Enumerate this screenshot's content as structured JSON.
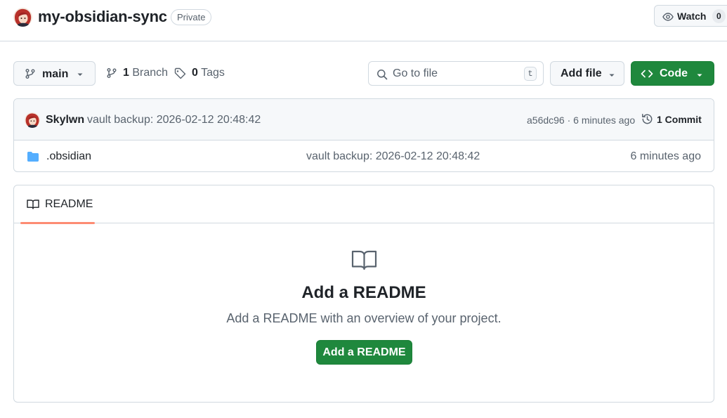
{
  "repo": {
    "name": "my-obsidian-sync",
    "visibility": "Private"
  },
  "watch": {
    "label": "Watch",
    "count": "0"
  },
  "toolbar": {
    "branch_current": "main",
    "branches_count": "1",
    "branches_label": "Branch",
    "tags_count": "0",
    "tags_label": "Tags",
    "search_placeholder": "Go to file",
    "search_shortcut": "t",
    "add_file_label": "Add file",
    "code_label": "Code"
  },
  "latest_commit": {
    "author": "Skylwn",
    "message": "vault backup: 2026-02-12 20:48:42",
    "sha_and_time": "a56dc96 · 6 minutes ago",
    "commit_count_label": "1 Commit"
  },
  "files": [
    {
      "name": ".obsidian",
      "type": "folder",
      "message": "vault backup: 2026-02-12 20:48:42",
      "age": "6 minutes ago"
    }
  ],
  "readme": {
    "tab_label": "README",
    "empty_title": "Add a README",
    "empty_description": "Add a README with an overview of your project.",
    "button_label": "Add a README"
  },
  "colors": {
    "primary_green": "#1f883d",
    "border": "#d1d9e0",
    "muted_text": "#59636e",
    "folder_blue": "#54aeff",
    "tab_underline": "#fd8c73"
  },
  "icons": [
    "repo-avatar",
    "eye-icon",
    "git-branch-icon",
    "tag-icon",
    "search-icon",
    "triangle-down-icon",
    "code-icon",
    "history-icon",
    "folder-icon",
    "book-icon"
  ]
}
